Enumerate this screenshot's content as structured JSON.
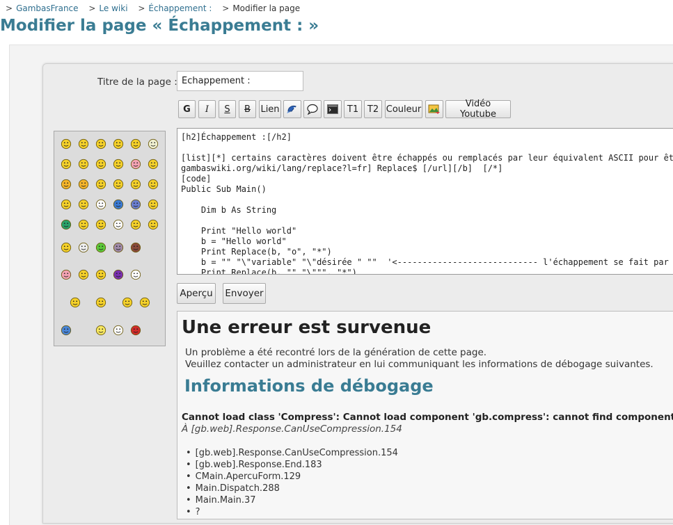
{
  "breadcrumb": {
    "items": [
      "GambasFrance",
      "Le wiki",
      "Échappement :"
    ],
    "current": "Modifier la page"
  },
  "page_title": "Modifier la page « Échappement : »",
  "form": {
    "title_label": "Titre de la page :",
    "title_value": "Échappement :"
  },
  "toolbar": {
    "bold": "G",
    "italic": "I",
    "underline": "S",
    "strike": "B",
    "link": "Lien",
    "sub": "T1",
    "sup": "T2",
    "color": "Couleur",
    "youtube": "Vidéo Youtube"
  },
  "editor": {
    "lines": [
      "[h2]Échappement :[/h2]",
      "",
      "[list][*] certains caractères doivent être échappés ou remplacés par leur équivalent ASCII pour ête",
      "gambaswiki.org/wiki/lang/replace?l=fr] Replace$ [/url][/b]  [/*]",
      "[code]",
      "Public Sub Main()",
      "",
      "    Dim b As String",
      "",
      "    Print \"Hello world\"",
      "    b = \"Hello world\"",
      "    Print Replace(b, \"o\", \"*\")",
      "    b = \"\" \"\\\"variable\" \"\\\"désirée \" \"\"  '<---------------------------- l'échappement se fait par",
      "    Print Replace(b, \"\" \"\\\"\"\", \"*\")"
    ]
  },
  "actions": {
    "preview": "Aperçu",
    "send": "Envoyer"
  },
  "error": {
    "title": "Une erreur est survenue",
    "message_1": "Un problème a été recontré lors de la génération de cette page.",
    "message_2": "Veuillez contacter un administrateur en lui communiquant les informations de débogage suivantes.",
    "debug_title": "Informations de débogage",
    "class_error": "Cannot load class 'Compress': Cannot load component 'gb.compress': cannot find component",
    "location": "À [gb.web].Response.CanUseCompression.154",
    "stack": [
      "[gb.web].Response.CanUseCompression.154",
      "[gb.web].Response.End.183",
      "CMain.ApercuForm.129",
      "Main.Dispatch.288",
      "Main.Main.37",
      "?"
    ]
  },
  "colors": {
    "title": "#3a7c93",
    "link": "#2f6f8f",
    "smiley_yellow": "#f5d12a"
  }
}
